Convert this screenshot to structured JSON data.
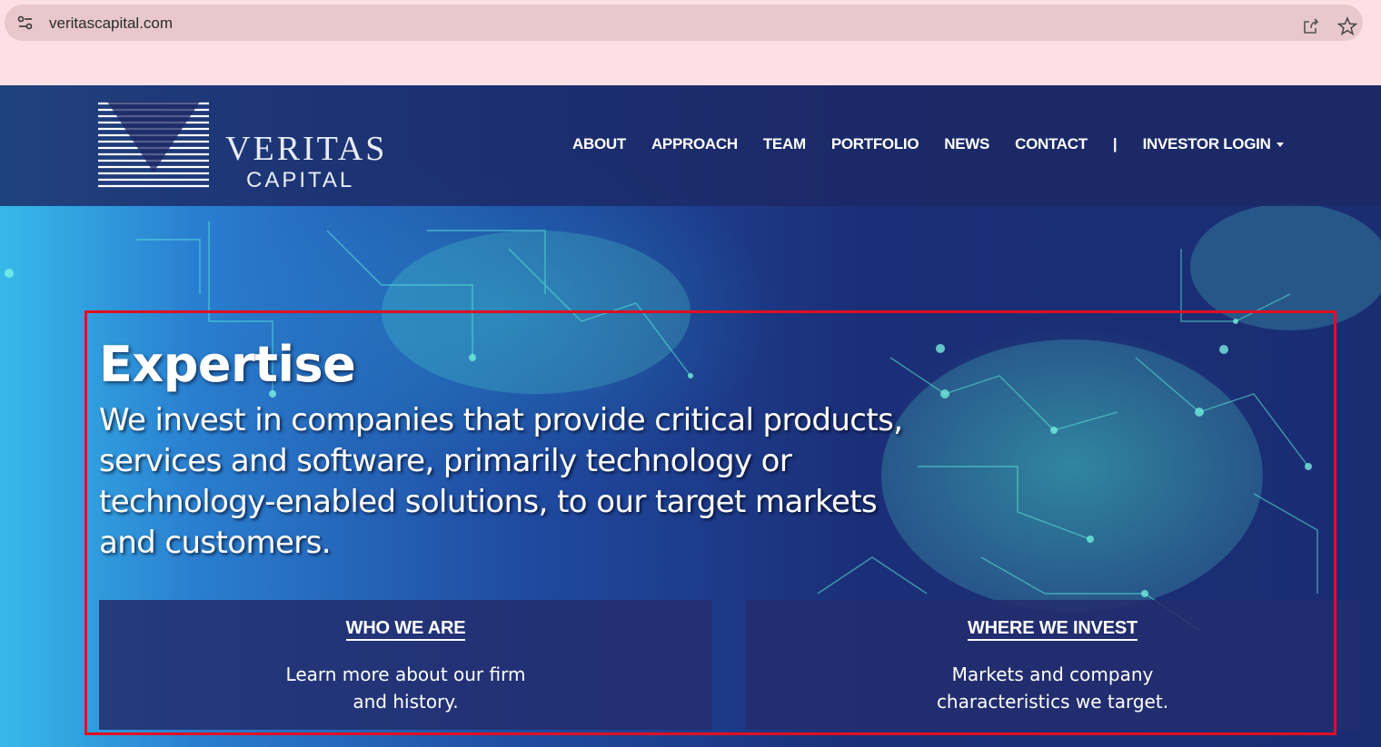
{
  "browser": {
    "url": "veritascapital.com"
  },
  "logo": {
    "line1": "VERITAS",
    "line2": "CAPITAL"
  },
  "nav": {
    "items": [
      "ABOUT",
      "APPROACH",
      "TEAM",
      "PORTFOLIO",
      "NEWS",
      "CONTACT"
    ],
    "separator": "|",
    "login": "INVESTOR LOGIN"
  },
  "hero": {
    "title": "Expertise",
    "text": "We invest in companies that provide critical products, services and software, primarily technology or technology-enabled solutions, to our target markets and customers."
  },
  "cards": [
    {
      "title": "WHO WE ARE",
      "description": "Learn more about our firm and history."
    },
    {
      "title": "WHERE WE INVEST",
      "description": "Markets and company characteristics we target."
    }
  ],
  "colors": {
    "header_bg": "#1c2864",
    "highlight_border": "#e01020",
    "card_bg": "#232d6e",
    "glow": "#40e0c8"
  },
  "icons": [
    "site-info-icon",
    "share-icon",
    "star-icon",
    "dropdown-caret-icon"
  ]
}
